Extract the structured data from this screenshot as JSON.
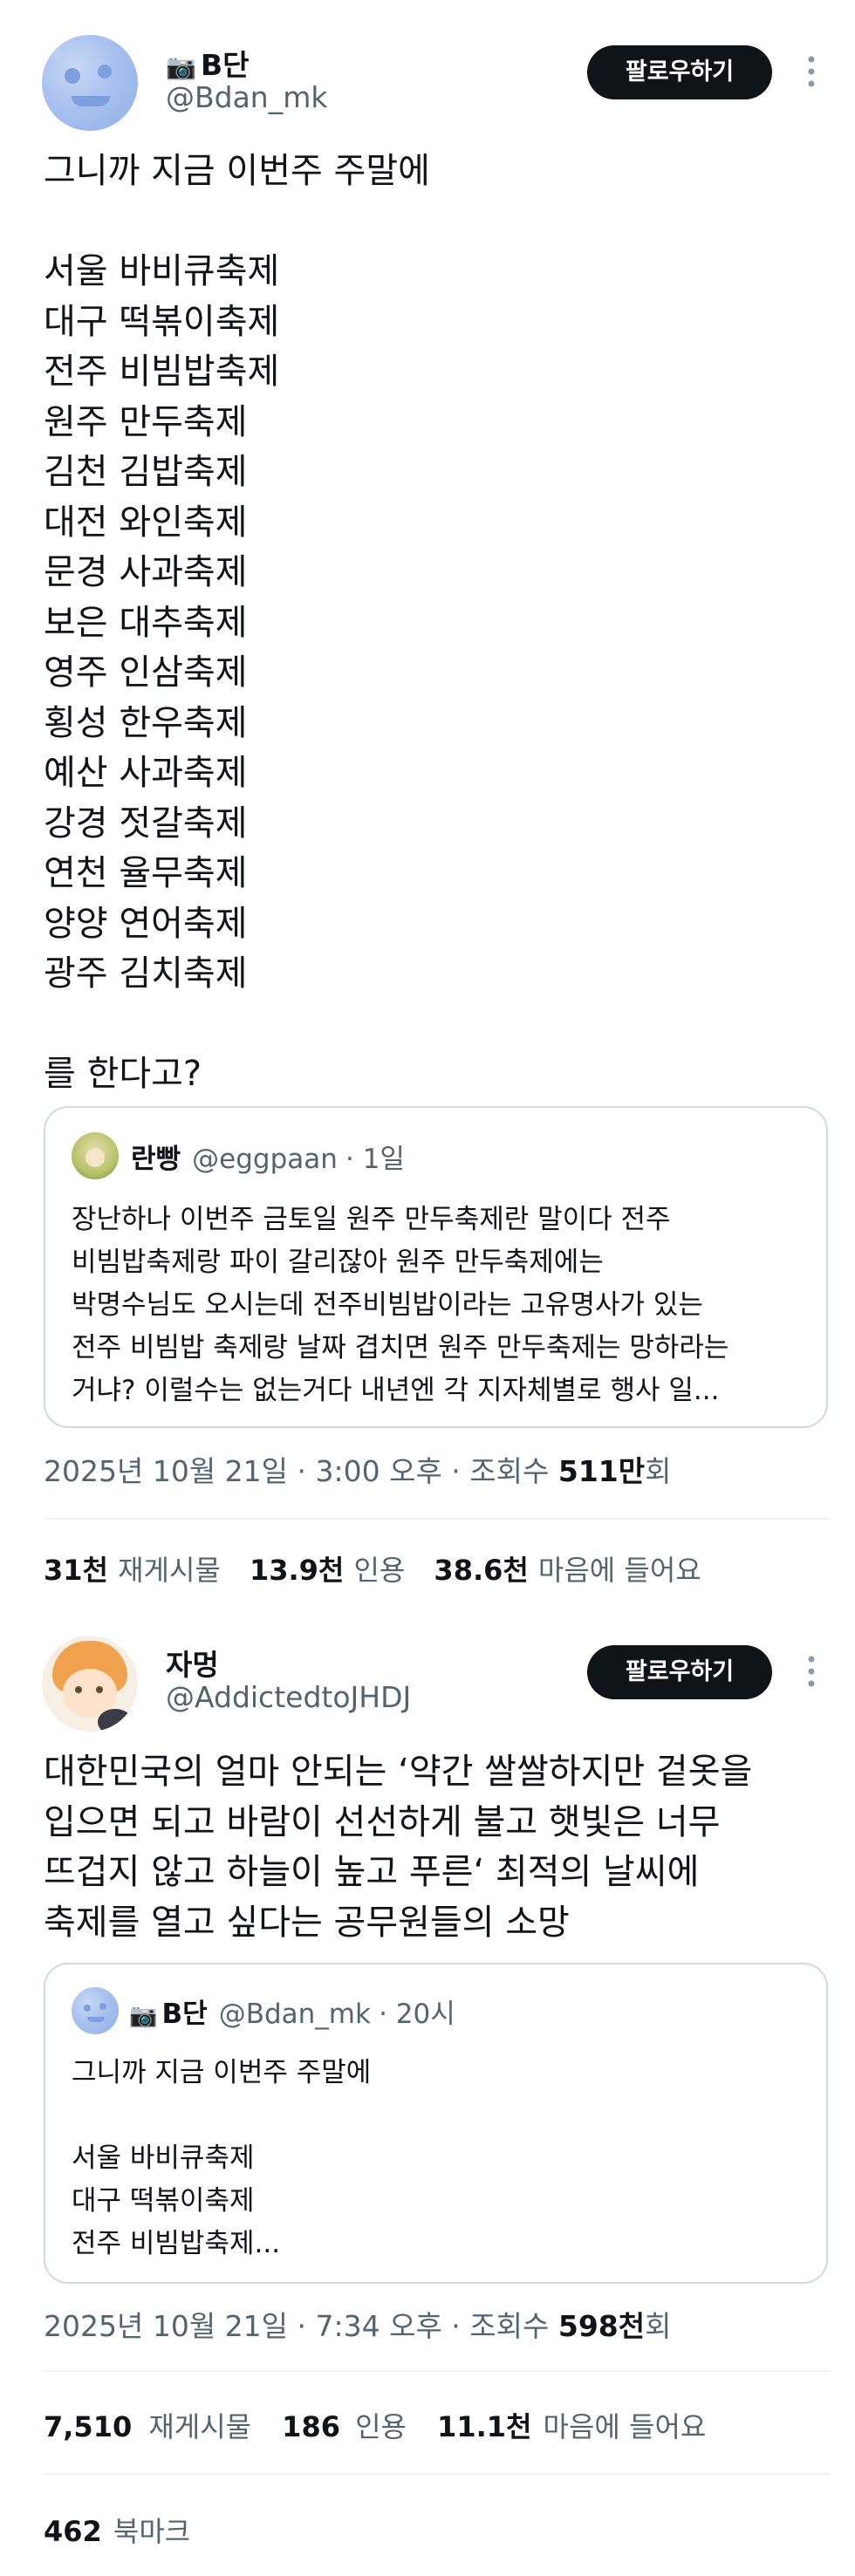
{
  "tweet1": {
    "display_name": "B단",
    "name_icon": "camera-icon",
    "handle": "@Bdan_mk",
    "follow_label": "팔로우하기",
    "text": "그니까 지금 이번주 주말에\n\n서울 바비큐축제\n대구 떡볶이축제\n전주 비빔밥축제\n원주 만두축제\n김천 김밥축제\n대전 와인축제\n문경 사과축제\n보은 대추축제\n영주 인삼축제\n횡성 한우축제\n예산 사과축제\n강경 젓갈축제\n연천 율무축제\n양양 연어축제\n광주 김치축제\n\n를 한다고?",
    "quote": {
      "name": "란빵",
      "handle": "@eggpaan",
      "time": "· 1일",
      "text": "장난하나 이번주 금토일 원주 만두축제란 말이다 전주\n비빔밥축제랑 파이 갈리잖아 원주 만두축제에는\n박명수님도 오시는데 전주비빔밥이라는 고유명사가 있는\n전주 비빔밥 축제랑 날짜 겹치면 원주 만두축제는 망하라는\n거냐? 이럴수는 없는거다 내년엔 각 지자체별로 행사 일..."
    },
    "meta_prefix": "2025년 10월 21일 · 3:00 오후 · 조회수 ",
    "views": "511만",
    "views_suffix": "회",
    "retweets_num": "31천",
    "retweets_label": "재게시물",
    "quotes_num": "13.9천",
    "quotes_label": "인용",
    "likes_num": "38.6천",
    "likes_label": "마음에 들어요"
  },
  "tweet2": {
    "display_name": "자멍",
    "handle": "@AddictedtoJHDJ",
    "follow_label": "팔로우하기",
    "text": "대한민국의 얼마 안되는 ‘약간 쌀쌀하지만 겉옷을\n입으면 되고 바람이 선선하게 불고 햇빛은 너무\n뜨겁지 않고 하늘이 높고 푸른‘ 최적의 날씨에\n축제를 열고 싶다는 공무원들의 소망",
    "quote": {
      "name": "B단",
      "handle": "@Bdan_mk",
      "time": "· 20시",
      "text": "그니까 지금 이번주 주말에\n\n서울 바비큐축제\n대구 떡볶이축제\n전주 비빔밥축제..."
    },
    "meta_prefix": "2025년 10월 21일 · 7:34 오후 · 조회수 ",
    "views": "598천",
    "views_suffix": "회",
    "retweets_num": "7,510",
    "retweets_label": "재게시물",
    "quotes_num": "186",
    "quotes_label": "인용",
    "likes_num": "11.1천",
    "likes_label": "마음에 들어요",
    "bookmarks_num": "462",
    "bookmarks_label": "북마크"
  },
  "colors": {
    "text": "#0f1419",
    "secondary": "#536471",
    "border": "#cfd9de",
    "follow_bg": "#0f1419"
  }
}
